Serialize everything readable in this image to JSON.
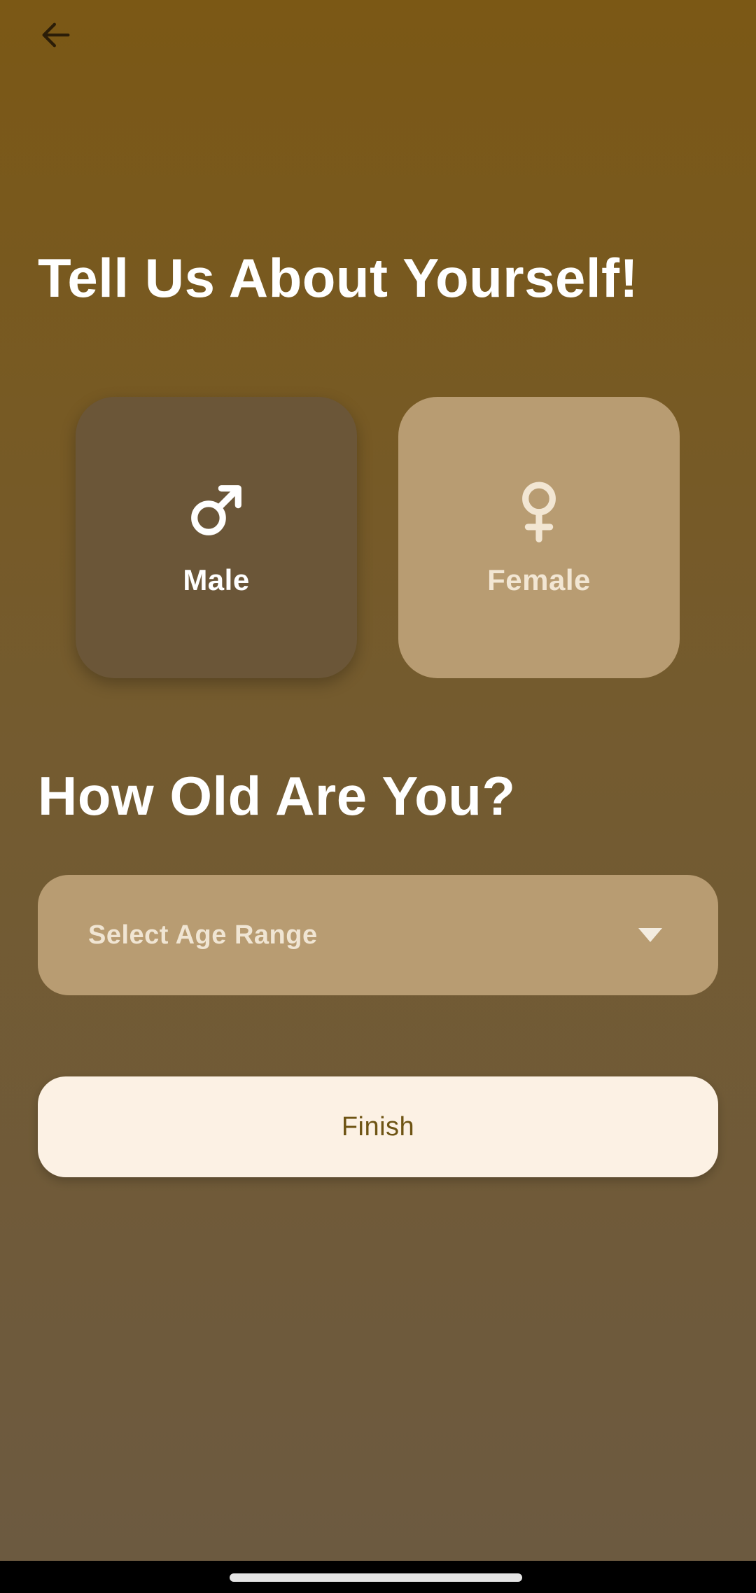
{
  "header": {
    "back_icon": "arrow-left-icon"
  },
  "gender_section": {
    "title": "Tell Us About Yourself!",
    "options": [
      {
        "label": "Male",
        "icon": "male-symbol-icon",
        "selected": true
      },
      {
        "label": "Female",
        "icon": "female-symbol-icon",
        "selected": false
      }
    ]
  },
  "age_section": {
    "title": "How Old Are You?",
    "select_placeholder": "Select Age Range",
    "select_icon": "caret-down-icon"
  },
  "actions": {
    "finish_label": "Finish"
  },
  "colors": {
    "background_top": "#7b5815",
    "background_bottom": "#6c5a41",
    "card_selected": "#6b5638",
    "card_unselected": "#b89c72",
    "button_bg": "#fcf1e4",
    "button_text": "#6e5414"
  }
}
